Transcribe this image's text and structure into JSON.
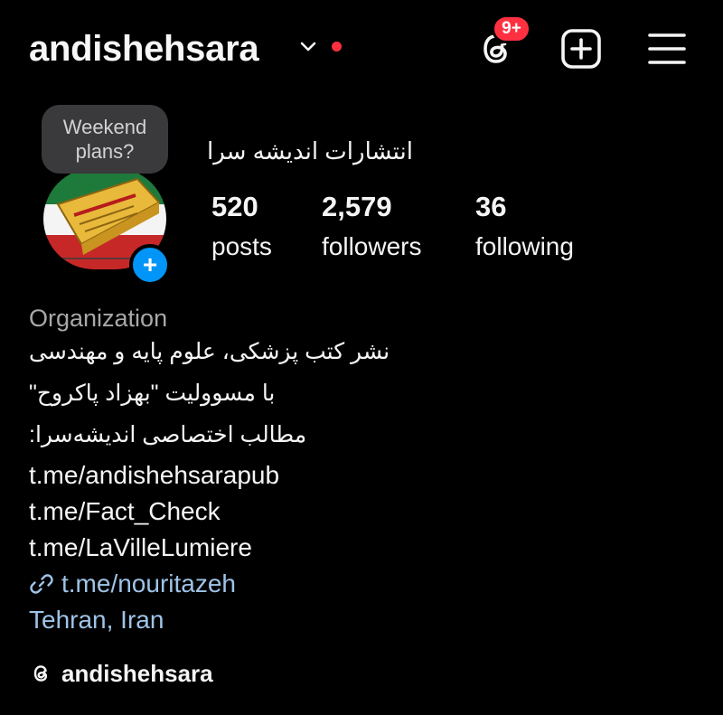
{
  "header": {
    "username": "andishehsara",
    "notification_badge": "9+",
    "icons": {
      "threads": "threads-icon",
      "new_post": "plus-square-icon",
      "menu": "hamburger-menu-icon",
      "account_switcher": "chevron-down-icon"
    }
  },
  "profile": {
    "note": "Weekend plans?",
    "display_name": "انتشارات اندیشه سرا",
    "stats": [
      {
        "value": "520",
        "label": "posts"
      },
      {
        "value": "2,579",
        "label": "followers"
      },
      {
        "value": "36",
        "label": "following"
      }
    ],
    "add_story_symbol": "+"
  },
  "bio": {
    "category": "Organization",
    "lines": [
      "نشر کتب پزشکی، علوم پایه و مهندسی",
      "با مسوولیت \"بهزاد پاکروح\"",
      "مطالب اختصاصی اندیشه‌سرا:"
    ],
    "links": [
      "t.me/andishehsarapub",
      "t.me/Fact_Check",
      "t.me/LaVilleLumiere"
    ],
    "external_link": "t.me/nouritazeh",
    "location": "Tehran, Iran",
    "threads_handle": "andishehsara"
  },
  "colors": {
    "background": "#000000",
    "text": "#f5f5f5",
    "muted": "#a8a8a8",
    "link": "#9fc3e7",
    "badge": "#ff3040",
    "accent": "#0095f6",
    "note_bubble": "#3a3a3c"
  }
}
